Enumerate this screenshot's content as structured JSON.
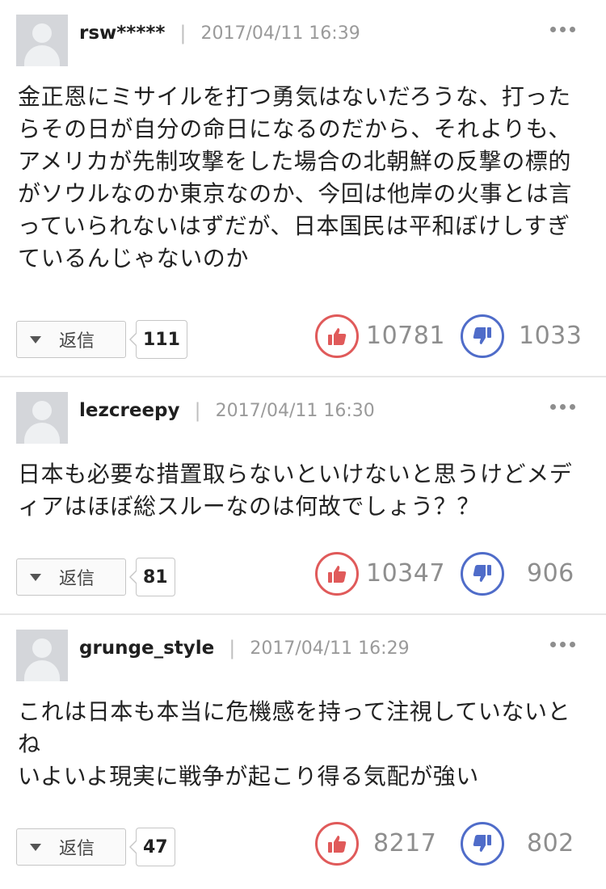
{
  "colors": {
    "like": "#e05a5a",
    "dislike": "#4f6cc9",
    "divider": "#e6e6e6"
  },
  "icons": {
    "avatar": "default-user-avatar",
    "more": "three-dots-icon",
    "like": "thumbs-up-icon",
    "dislike": "thumbs-down-icon",
    "reply": "triangle-down-icon"
  },
  "comments": [
    {
      "username": "rsw*****",
      "separator": "|",
      "date": "2017/04/11 16:39",
      "text": "金正恩にミサイルを打つ勇気はないだろうな、打ったらその日が自分の命日になるのだから、それよりも、アメリカが先制攻撃をした場合の北朝鮮の反撃の標的がソウルなのか東京なのか、今回は他岸の火事とは言っていられないはずだが、日本国民は平和ぼけしすぎているんじゃないのか",
      "reply_label": "返信",
      "reply_count": "111",
      "likes": "10781",
      "dislikes": "1033"
    },
    {
      "username": "lezcreepy",
      "separator": "|",
      "date": "2017/04/11 16:30",
      "text": "日本も必要な措置取らないといけないと思うけどメディアはほぼ総スルーなのは何故でしょう？？",
      "reply_label": "返信",
      "reply_count": "81",
      "likes": "10347",
      "dislikes": "906"
    },
    {
      "username": "grunge_style",
      "separator": "|",
      "date": "2017/04/11 16:29",
      "text": "これは日本も本当に危機感を持って注視していないとね\nいよいよ現実に戦争が起こり得る気配が強い",
      "reply_label": "返信",
      "reply_count": "47",
      "likes": "8217",
      "dislikes": "802"
    }
  ]
}
